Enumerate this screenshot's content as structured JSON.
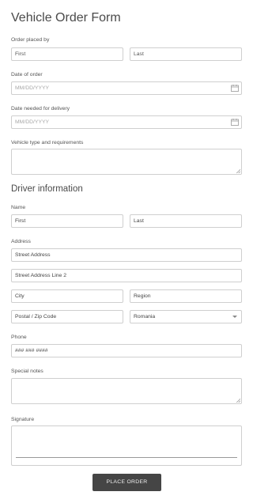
{
  "form": {
    "title": "Vehicle Order Form",
    "order_placed_by": {
      "label": "Order placed by",
      "first_placeholder": "First",
      "last_placeholder": "Last"
    },
    "date_of_order": {
      "label": "Date of order",
      "placeholder": "MM/DD/YYYY",
      "icon": "calendar-icon"
    },
    "date_needed": {
      "label": "Date needed for delivery",
      "placeholder": "MM/DD/YYYY",
      "icon": "calendar-icon"
    },
    "vehicle_type": {
      "label": "Vehicle type and requirements"
    },
    "driver_section_title": "Driver information",
    "name": {
      "label": "Name",
      "first_placeholder": "First",
      "last_placeholder": "Last"
    },
    "address": {
      "label": "Address",
      "street_placeholder": "Street Address",
      "street2_placeholder": "Street Address Line 2",
      "city_placeholder": "City",
      "region_placeholder": "Region",
      "zip_placeholder": "Postal / Zip Code",
      "country_value": "Romania"
    },
    "phone": {
      "label": "Phone",
      "placeholder": "### ### ####"
    },
    "special_notes": {
      "label": "Special notes"
    },
    "signature": {
      "label": "Signature"
    },
    "submit_label": "PLACE ORDER"
  }
}
